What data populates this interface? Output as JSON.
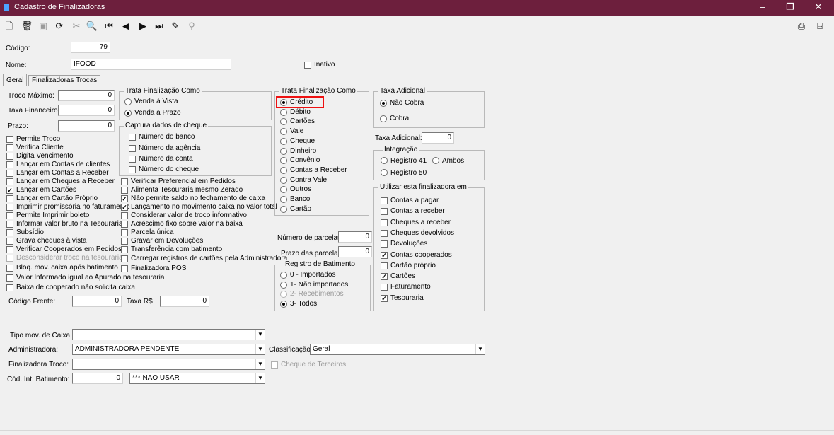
{
  "window": {
    "title": "Cadastro de Finalizadoras",
    "min": "–",
    "restore": "❐",
    "close": "✕"
  },
  "toolbar": {
    "icons": [
      "new-icon",
      "delete-icon",
      "save-icon",
      "refresh-icon",
      "cancel-icon",
      "search-icon",
      "first-icon",
      "prev-icon",
      "next-icon",
      "last-icon",
      "filter-icon",
      "binoculars-icon",
      "print-icon",
      "exit-icon"
    ]
  },
  "header": {
    "codigo_label": "Código:",
    "codigo_value": "79",
    "nome_label": "Nome:",
    "nome_value": "IFOOD",
    "inativo_label": "Inativo"
  },
  "tabs": [
    {
      "label": "Geral"
    },
    {
      "label": "Finalizadoras Trocas"
    }
  ],
  "geral": {
    "troco_maximo_label": "Troco Máximo:",
    "troco_maximo_value": "0",
    "taxa_financeiro_label": "Taxa Financeiro:",
    "taxa_financeiro_value": "0",
    "prazo_label": "Prazo:",
    "prazo_value": "0",
    "codigo_frente_label": "Código Frente:",
    "codigo_frente_value": "0",
    "taxa_rs_label": "Taxa R$",
    "taxa_rs_value": "0"
  },
  "checks_col1": [
    {
      "label": "Permite Troco",
      "checked": false,
      "disabled": false
    },
    {
      "label": "Verifica Cliente",
      "checked": false,
      "disabled": false
    },
    {
      "label": "Digita Vencimento",
      "checked": false,
      "disabled": false
    },
    {
      "label": "Lançar em Contas de clientes",
      "checked": false,
      "disabled": false
    },
    {
      "label": "Lançar em Contas a Receber",
      "checked": false,
      "disabled": false
    },
    {
      "label": "Lançar em Cheques a Receber",
      "checked": false,
      "disabled": false
    },
    {
      "label": "Lançar em Cartões",
      "checked": true,
      "disabled": false
    },
    {
      "label": "Lançar em Cartão Próprio",
      "checked": false,
      "disabled": false
    },
    {
      "label": "Imprimir promissória no faturamento",
      "checked": false,
      "disabled": false
    },
    {
      "label": "Permite Imprimir boleto",
      "checked": false,
      "disabled": false
    },
    {
      "label": "Informar valor bruto na Tesouraria",
      "checked": false,
      "disabled": false
    },
    {
      "label": "Subsídio",
      "checked": false,
      "disabled": false
    },
    {
      "label": "Grava cheques à vista",
      "checked": false,
      "disabled": false
    },
    {
      "label": "Verificar Cooperados em Pedidos",
      "checked": false,
      "disabled": false
    },
    {
      "label": "Desconsiderar troco na tesouraria",
      "checked": false,
      "disabled": true
    },
    {
      "label": "Bloq. mov. caixa após batimento",
      "checked": false,
      "disabled": false
    },
    {
      "label": "Valor Informado igual ao Apurado na tesouraria",
      "checked": false,
      "disabled": false
    },
    {
      "label": "Baixa de cooperado não solicita caixa",
      "checked": false,
      "disabled": false
    }
  ],
  "trata_como_1": {
    "title": "Trata Finalização Como",
    "options": [
      {
        "label": "Venda à Vista",
        "selected": false
      },
      {
        "label": "Venda a Prazo",
        "selected": true
      }
    ]
  },
  "captura_cheque": {
    "title": "Captura dados de cheque",
    "items": [
      {
        "label": "Número do banco",
        "checked": false
      },
      {
        "label": "Número da agência",
        "checked": false
      },
      {
        "label": "Número da conta",
        "checked": false
      },
      {
        "label": "Número do cheque",
        "checked": false
      }
    ]
  },
  "checks_col2": [
    {
      "label": "Verificar Preferencial em Pedidos",
      "checked": false
    },
    {
      "label": "Alimenta Tesouraria mesmo Zerado",
      "checked": false
    },
    {
      "label": "Não permite saldo no fechamento de caixa",
      "checked": true
    },
    {
      "label": "Lançamento no movimento caixa no valor total",
      "checked": true
    },
    {
      "label": "Considerar valor de troco informativo",
      "checked": false
    },
    {
      "label": "Acréscimo fixo sobre valor na baixa",
      "checked": false
    },
    {
      "label": "Parcela única",
      "checked": false
    },
    {
      "label": "Gravar em Devoluções",
      "checked": false
    },
    {
      "label": "Transferência com batimento",
      "checked": false
    },
    {
      "label": "Carregar registros de cartões pela Administradora",
      "checked": false
    },
    {
      "label": "Finalizadora POS",
      "checked": false
    }
  ],
  "trata_como_2": {
    "title": "Trata Finalização Como",
    "options": [
      {
        "label": "Crédito",
        "selected": true
      },
      {
        "label": "Débito",
        "selected": false
      },
      {
        "label": "Cartões",
        "selected": false
      },
      {
        "label": "Vale",
        "selected": false
      },
      {
        "label": "Cheque",
        "selected": false
      },
      {
        "label": "Dinheiro",
        "selected": false
      },
      {
        "label": "Convênio",
        "selected": false
      },
      {
        "label": "Contas a Receber",
        "selected": false
      },
      {
        "label": "Contra Vale",
        "selected": false
      },
      {
        "label": "Outros",
        "selected": false
      },
      {
        "label": "Banco",
        "selected": false
      },
      {
        "label": "Cartão",
        "selected": false
      }
    ]
  },
  "parcelas": {
    "num_label": "Número de parcelas:",
    "num_value": "0",
    "prazo_label": "Prazo das parcelas:",
    "prazo_value": "0"
  },
  "registro_batimento": {
    "title": "Registro de Batimento",
    "options": [
      {
        "label": "0 - Importados",
        "selected": false,
        "disabled": false
      },
      {
        "label": "1- Não importados",
        "selected": false,
        "disabled": false
      },
      {
        "label": "2- Recebimentos",
        "selected": false,
        "disabled": true
      },
      {
        "label": "3- Todos",
        "selected": true,
        "disabled": false
      }
    ]
  },
  "taxa_adicional": {
    "title": "Taxa Adicional",
    "options": [
      {
        "label": "Não Cobra",
        "selected": true
      },
      {
        "label": "Cobra",
        "selected": false
      }
    ],
    "field_label": "Taxa Adicional:",
    "field_value": "0"
  },
  "integracao": {
    "title": "Integração",
    "options": [
      {
        "label": "Registro 41",
        "selected": false
      },
      {
        "label": "Ambos",
        "selected": false
      },
      {
        "label": "Registro 50",
        "selected": false
      }
    ]
  },
  "utilizar": {
    "title": "Utilizar esta finalizadora em",
    "items": [
      {
        "label": "Contas a pagar",
        "checked": false
      },
      {
        "label": "Contas a receber",
        "checked": false
      },
      {
        "label": "Cheques a receber",
        "checked": false
      },
      {
        "label": "Cheques devolvidos",
        "checked": false
      },
      {
        "label": "Devoluções",
        "checked": false
      },
      {
        "label": "Contas cooperados",
        "checked": true
      },
      {
        "label": "Cartão próprio",
        "checked": false
      },
      {
        "label": "Cartões",
        "checked": true
      },
      {
        "label": "Faturamento",
        "checked": false
      },
      {
        "label": "Tesouraria",
        "checked": true
      }
    ]
  },
  "bottom": {
    "tipo_mov_label": "Tipo mov. de Caixa",
    "tipo_mov_value": "",
    "administradora_label": "Administradora:",
    "administradora_value": "ADMINISTRADORA PENDENTE",
    "classificacao_label": "Classificação:",
    "classificacao_value": "Geral",
    "fin_troco_label": "Finalizadora Troco:",
    "fin_troco_value": "",
    "cheque_terceiros_label": "Cheque de Terceiros",
    "cod_int_label": "Cód. Int. Batimento:",
    "cod_int_value": "0",
    "nao_usar_value": "*** NAO USAR"
  }
}
